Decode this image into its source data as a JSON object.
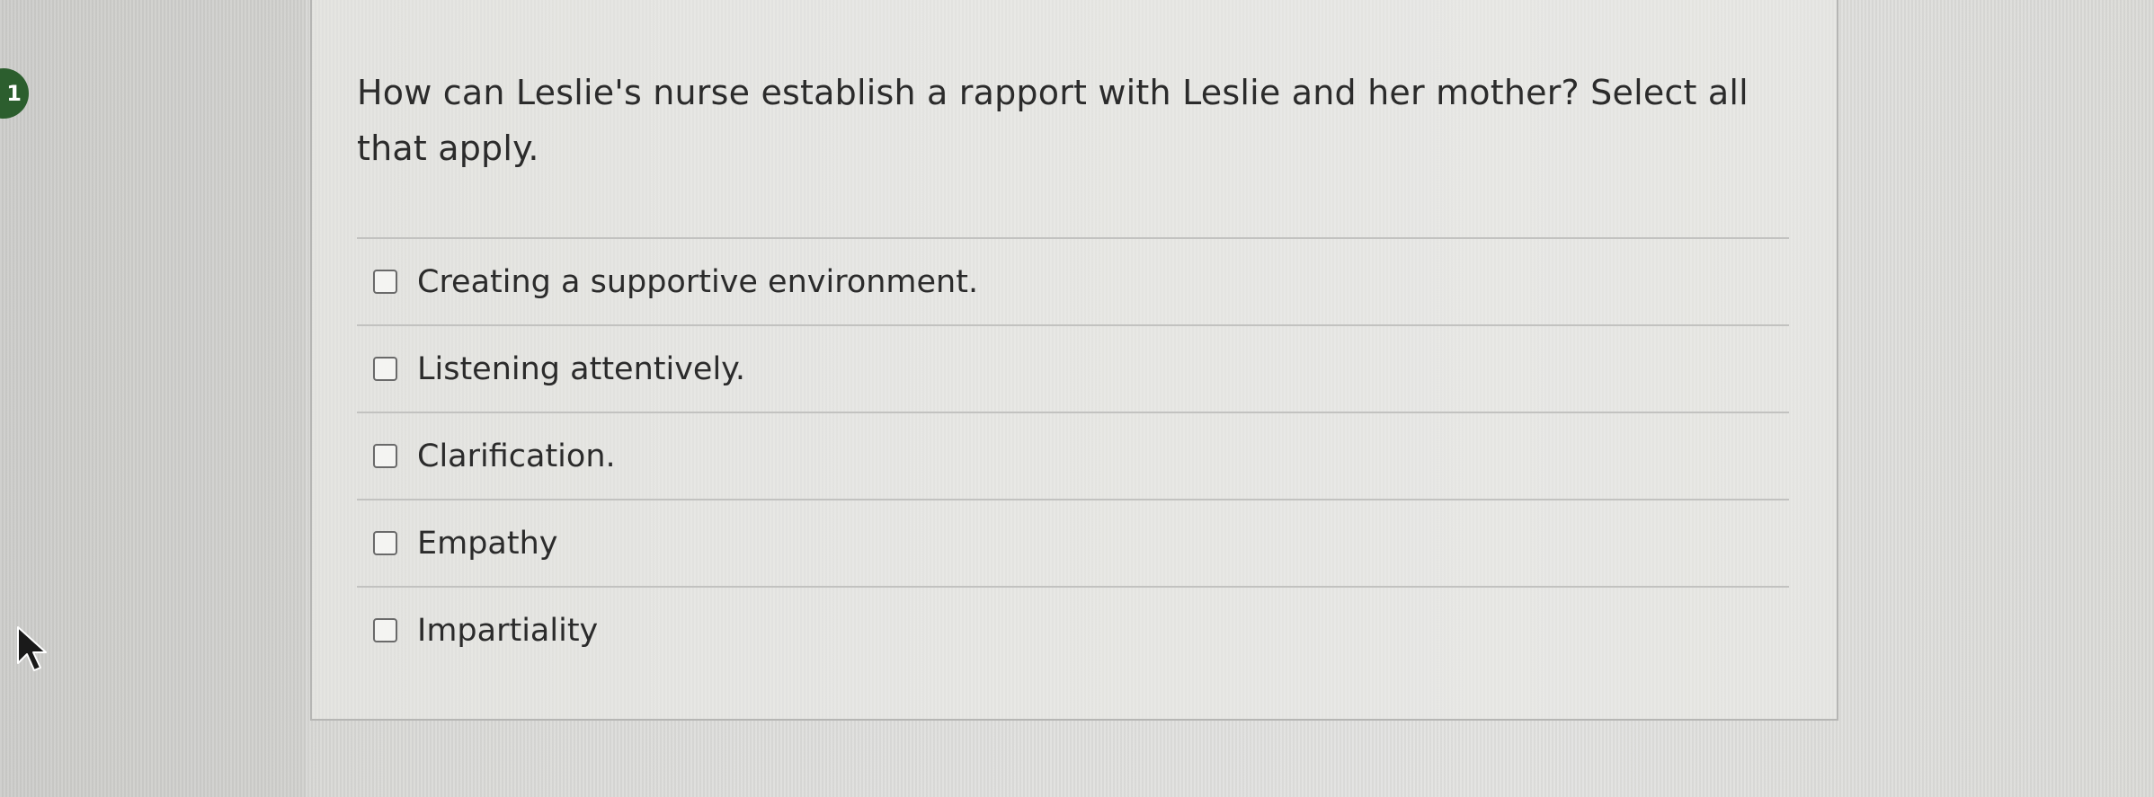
{
  "question": {
    "number": "1",
    "prompt": "How can Leslie's nurse establish a rapport with Leslie and her mother? Select all that apply.",
    "options": [
      {
        "label": "Creating a supportive environment.",
        "checked": false
      },
      {
        "label": "Listening attentively.",
        "checked": false
      },
      {
        "label": "Clarification.",
        "checked": false
      },
      {
        "label": "Empathy",
        "checked": false
      },
      {
        "label": "Impartiality",
        "checked": false
      }
    ]
  },
  "colors": {
    "badge": "#2c5e2e",
    "text": "#2b2b2b",
    "divider": "#c2c2c0",
    "checkbox_border": "#6a6a6a"
  },
  "icons": {
    "cursor": "mouse-pointer-arrow"
  }
}
